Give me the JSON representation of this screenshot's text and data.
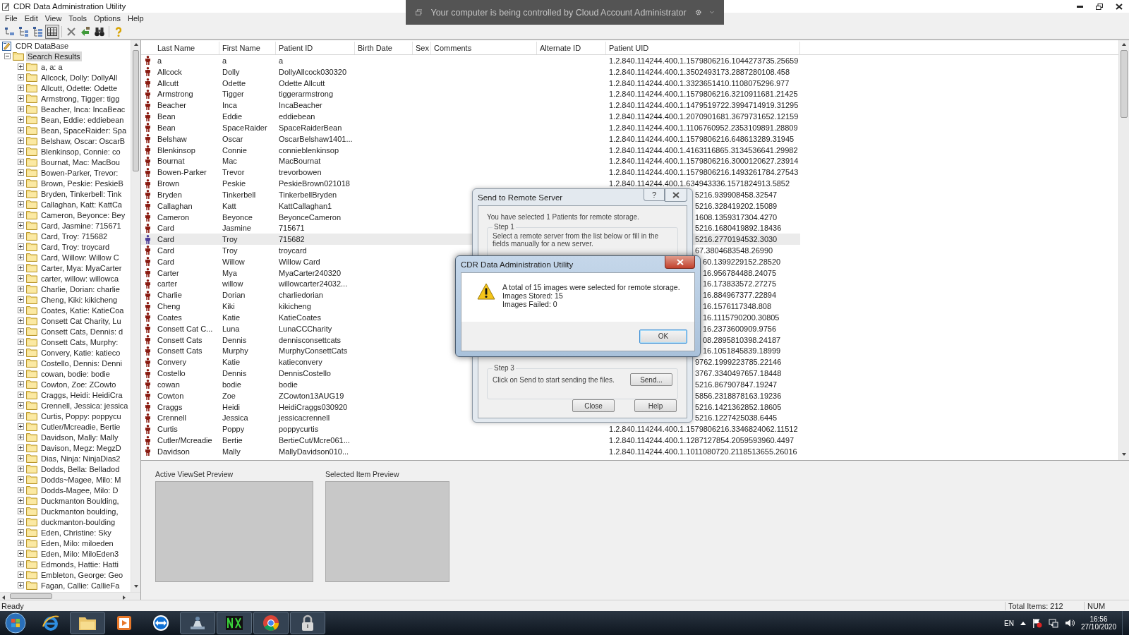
{
  "window": {
    "title": "CDR Data Administration Utility"
  },
  "remote_banner": {
    "text": "Your computer is being controlled by Cloud Account Administrator"
  },
  "menu": [
    "File",
    "Edit",
    "View",
    "Tools",
    "Options",
    "Help"
  ],
  "toolbar": [
    {
      "selected": false
    },
    {
      "selected": false
    },
    {
      "selected": false
    },
    {
      "selected": true
    },
    {
      "selected": false
    },
    {
      "selected": false
    },
    {
      "selected": false
    },
    {
      "selected": false
    }
  ],
  "tree": {
    "root": {
      "label": "CDR DataBase",
      "children": [
        {
          "label": "Search Results",
          "expanded": true,
          "selected": true,
          "children": [
            {
              "label": "a, a: a",
              "expanded": false,
              "selected": false
            },
            {
              "label": "Allcock, Dolly: DollyAll",
              "expanded": false,
              "selected": false
            },
            {
              "label": "Allcutt, Odette: Odette",
              "expanded": false,
              "selected": false
            },
            {
              "label": "Armstrong, Tigger: tigg",
              "expanded": false,
              "selected": false
            },
            {
              "label": "Beacher, Inca: IncaBeac",
              "expanded": false,
              "selected": false
            },
            {
              "label": "Bean, Eddie: eddiebean",
              "expanded": false,
              "selected": false
            },
            {
              "label": "Bean, SpaceRaider: Spa",
              "expanded": false,
              "selected": false
            },
            {
              "label": "Belshaw, Oscar: OscarB",
              "expanded": false,
              "selected": false
            },
            {
              "label": "Blenkinsop, Connie: co",
              "expanded": false,
              "selected": false
            },
            {
              "label": "Bournat, Mac: MacBou",
              "expanded": false,
              "selected": false
            },
            {
              "label": "Bowen-Parker, Trevor:",
              "expanded": false,
              "selected": false
            },
            {
              "label": "Brown, Peskie: PeskieB",
              "expanded": false,
              "selected": false
            },
            {
              "label": "Bryden, Tinkerbell: Tink",
              "expanded": false,
              "selected": false
            },
            {
              "label": "Callaghan, Katt: KattCa",
              "expanded": false,
              "selected": false
            },
            {
              "label": "Cameron, Beyonce: Bey",
              "expanded": false,
              "selected": false
            },
            {
              "label": "Card, Jasmine: 715671",
              "expanded": false,
              "selected": false
            },
            {
              "label": "Card, Troy: 715682",
              "expanded": false,
              "selected": false
            },
            {
              "label": "Card, Troy: troycard",
              "expanded": false,
              "selected": false
            },
            {
              "label": "Card, Willow: Willow C",
              "expanded": false,
              "selected": false
            },
            {
              "label": "Carter, Mya: MyaCarter",
              "expanded": false,
              "selected": false
            },
            {
              "label": "carter, willow: willowca",
              "expanded": false,
              "selected": false
            },
            {
              "label": "Charlie, Dorian: charlie",
              "expanded": false,
              "selected": false
            },
            {
              "label": "Cheng, Kiki: kikicheng",
              "expanded": false,
              "selected": false
            },
            {
              "label": "Coates, Katie: KatieCoa",
              "expanded": false,
              "selected": false
            },
            {
              "label": "Consett Cat Charity, Lu",
              "expanded": false,
              "selected": false
            },
            {
              "label": "Consett Cats, Dennis: d",
              "expanded": false,
              "selected": false
            },
            {
              "label": "Consett Cats, Murphy:",
              "expanded": false,
              "selected": false
            },
            {
              "label": "Convery, Katie: katieco",
              "expanded": false,
              "selected": false
            },
            {
              "label": "Costello, Dennis: Denni",
              "expanded": false,
              "selected": false
            },
            {
              "label": "cowan, bodie: bodie",
              "expanded": false,
              "selected": false
            },
            {
              "label": "Cowton, Zoe: ZCowto",
              "expanded": false,
              "selected": false
            },
            {
              "label": "Craggs, Heidi: HeidiCra",
              "expanded": false,
              "selected": false
            },
            {
              "label": "Crennell, Jessica: jessica",
              "expanded": false,
              "selected": false
            },
            {
              "label": "Curtis, Poppy: poppycu",
              "expanded": false,
              "selected": false
            },
            {
              "label": "Cutler/Mcreadie, Bertie",
              "expanded": false,
              "selected": false
            },
            {
              "label": "Davidson, Mally: Mally",
              "expanded": false,
              "selected": false
            },
            {
              "label": "Davison, Megz: MegzD",
              "expanded": false,
              "selected": false
            },
            {
              "label": "Dias, Ninja: NinjaDias2",
              "expanded": false,
              "selected": false
            },
            {
              "label": "Dodds, Bella: Belladod",
              "expanded": false,
              "selected": false
            },
            {
              "label": "Dodds~Magee, Milo: M",
              "expanded": false,
              "selected": false
            },
            {
              "label": "Dodds-Magee, Milo: D",
              "expanded": false,
              "selected": false
            },
            {
              "label": "Duckmanton Boulding,",
              "expanded": false,
              "selected": false
            },
            {
              "label": "Duckmanton boulding,",
              "expanded": false,
              "selected": false
            },
            {
              "label": "duckmanton-boulding",
              "expanded": false,
              "selected": false
            },
            {
              "label": "Eden, Christine: Sky",
              "expanded": false,
              "selected": false
            },
            {
              "label": "Eden, Milo: miloeden",
              "expanded": false,
              "selected": false
            },
            {
              "label": "Eden, Milo: MiloEden3",
              "expanded": false,
              "selected": false
            },
            {
              "label": "Edmonds, Hattie: Hatti",
              "expanded": false,
              "selected": false
            },
            {
              "label": "Embleton, George: Geo",
              "expanded": false,
              "selected": false
            },
            {
              "label": "Fagan, Callie: CallieFa",
              "expanded": false,
              "selected": false
            }
          ]
        }
      ]
    }
  },
  "table": {
    "columns": [
      "Last Name",
      "First Name",
      "Patient ID",
      "Birth Date",
      "Sex",
      "Comments",
      "Alternate ID",
      "Patient UID"
    ],
    "rows": [
      {
        "last_name": "a",
        "first_name": "a",
        "patient_id": "a",
        "patient_uid": "1.2.840.114244.400.1.1579806216.1044273735.25659",
        "selected": false
      },
      {
        "last_name": "Allcock",
        "first_name": "Dolly",
        "patient_id": "DollyAllcock030320",
        "patient_uid": "1.2.840.114244.400.1.3502493173.2887280108.458",
        "selected": false
      },
      {
        "last_name": "Allcutt",
        "first_name": "Odette",
        "patient_id": "Odette Allcutt",
        "patient_uid": "1.2.840.114244.400.1.3323651410.1108075296.977",
        "selected": false
      },
      {
        "last_name": "Armstrong",
        "first_name": "Tigger",
        "patient_id": "tiggerarmstrong",
        "patient_uid": "1.2.840.114244.400.1.1579806216.3210911681.21425",
        "selected": false
      },
      {
        "last_name": "Beacher",
        "first_name": "Inca",
        "patient_id": "IncaBeacher",
        "patient_uid": "1.2.840.114244.400.1.1479519722.3994714919.31295",
        "selected": false
      },
      {
        "last_name": "Bean",
        "first_name": "Eddie",
        "patient_id": "eddiebean",
        "patient_uid": "1.2.840.114244.400.1.2070901681.3679731652.12159",
        "selected": false
      },
      {
        "last_name": "Bean",
        "first_name": "SpaceRaider",
        "patient_id": "SpaceRaiderBean",
        "patient_uid": "1.2.840.114244.400.1.1106760952.2353109891.28809",
        "selected": false
      },
      {
        "last_name": "Belshaw",
        "first_name": "Oscar",
        "patient_id": "OscarBelshaw1401...",
        "patient_uid": "1.2.840.114244.400.1.1579806216.648613289.31945",
        "selected": false
      },
      {
        "last_name": "Blenkinsop",
        "first_name": "Connie",
        "patient_id": "connieblenkinsop",
        "patient_uid": "1.2.840.114244.400.1.4163116865.3134536641.29982",
        "selected": false
      },
      {
        "last_name": "Bournat",
        "first_name": "Mac",
        "patient_id": "MacBournat",
        "patient_uid": "1.2.840.114244.400.1.1579806216.3000120627.23914",
        "selected": false
      },
      {
        "last_name": "Bowen-Parker",
        "first_name": "Trevor",
        "patient_id": "trevorbowen",
        "patient_uid": "1.2.840.114244.400.1.1579806216.1493261784.27543",
        "selected": false
      },
      {
        "last_name": "Brown",
        "first_name": "Peskie",
        "patient_id": "PeskieBrown021018",
        "patient_uid": "1.2.840.114244.400.1.634943336.1571824913.5852",
        "selected": false
      },
      {
        "last_name": "Bryden",
        "first_name": "Tinkerbell",
        "patient_id": "TinkerbellBryden",
        "patient_uid": "5216.939908458.32547",
        "selected": false
      },
      {
        "last_name": "Callaghan",
        "first_name": "Katt",
        "patient_id": "KattCallaghan1",
        "patient_uid": "5216.328419202.15089",
        "selected": false
      },
      {
        "last_name": "Cameron",
        "first_name": "Beyonce",
        "patient_id": "BeyonceCameron",
        "patient_uid": "1608.1359317304.4270",
        "selected": false
      },
      {
        "last_name": "Card",
        "first_name": "Jasmine",
        "patient_id": "715671",
        "patient_uid": "5216.1680419892.18436",
        "selected": false
      },
      {
        "last_name": "Card",
        "first_name": "Troy",
        "patient_id": "715682",
        "patient_uid": "5216.2770194532.3030",
        "selected": true
      },
      {
        "last_name": "Card",
        "first_name": "Troy",
        "patient_id": "troycard",
        "patient_uid": "67.3804683548.26990",
        "selected": false
      },
      {
        "last_name": "Card",
        "first_name": "Willow",
        "patient_id": "Willow Card",
        "patient_uid": "60.1399229152.28520",
        "selected": false
      },
      {
        "last_name": "Carter",
        "first_name": "Mya",
        "patient_id": "MyaCarter240320",
        "patient_uid": "16.956784488.24075",
        "selected": false
      },
      {
        "last_name": "carter",
        "first_name": "willow",
        "patient_id": "willowcarter24032...",
        "patient_uid": "16.173833572.27275",
        "selected": false
      },
      {
        "last_name": "Charlie",
        "first_name": "Dorian",
        "patient_id": "charliedorian",
        "patient_uid": "16.884967377.22894",
        "selected": false
      },
      {
        "last_name": "Cheng",
        "first_name": "Kiki",
        "patient_id": "kikicheng",
        "patient_uid": "16.1576117348.808",
        "selected": false
      },
      {
        "last_name": "Coates",
        "first_name": "Katie",
        "patient_id": "KatieCoates",
        "patient_uid": "16.1115790200.30805",
        "selected": false
      },
      {
        "last_name": "Consett Cat C...",
        "first_name": "Luna",
        "patient_id": "LunaCCCharity",
        "patient_uid": "16.2373600909.9756",
        "selected": false
      },
      {
        "last_name": "Consett Cats",
        "first_name": "Dennis",
        "patient_id": "dennisconsettcats",
        "patient_uid": "08.2895810398.24187",
        "selected": false
      },
      {
        "last_name": "Consett Cats",
        "first_name": "Murphy",
        "patient_id": "MurphyConsettCats",
        "patient_uid": "16.1051845839.18999",
        "selected": false
      },
      {
        "last_name": "Convery",
        "first_name": "Katie",
        "patient_id": "katieconvery",
        "patient_uid": "9762.1999223785.22146",
        "selected": false
      },
      {
        "last_name": "Costello",
        "first_name": "Dennis",
        "patient_id": "DennisCostello",
        "patient_uid": "3767.3340497657.18448",
        "selected": false
      },
      {
        "last_name": "cowan",
        "first_name": "bodie",
        "patient_id": "bodie",
        "patient_uid": "5216.867907847.19247",
        "selected": false
      },
      {
        "last_name": "Cowton",
        "first_name": "Zoe",
        "patient_id": "ZCowton13AUG19",
        "patient_uid": "5856.2318878163.19236",
        "selected": false
      },
      {
        "last_name": "Craggs",
        "first_name": "Heidi",
        "patient_id": "HeidiCraggs030920",
        "patient_uid": "5216.1421362852.18605",
        "selected": false
      },
      {
        "last_name": "Crennell",
        "first_name": "Jessica",
        "patient_id": "jessicacrennell",
        "patient_uid": "5216.1227425038.6445",
        "selected": false
      },
      {
        "last_name": "Curtis",
        "first_name": "Poppy",
        "patient_id": "poppycurtis",
        "patient_uid": "1.2.840.114244.400.1.1579806216.3346824062.11512",
        "selected": false
      },
      {
        "last_name": "Cutler/Mcreadie",
        "first_name": "Bertie",
        "patient_id": "BertieCut/Mcre061...",
        "patient_uid": "1.2.840.114244.400.1.1287127854.2059593960.4497",
        "selected": false
      },
      {
        "last_name": "Davidson",
        "first_name": "Mally",
        "patient_id": "MallyDavidson010...",
        "patient_uid": "1.2.840.114244.400.1.1011080720.2118513655.26016",
        "selected": false
      }
    ]
  },
  "previews": [
    {
      "title": "Active ViewSet Preview"
    },
    {
      "title": "Selected Item Preview"
    }
  ],
  "send_dialog": {
    "title": "Send to Remote Server",
    "help_glyph": "?",
    "intro": "You have selected 1 Patients for remote storage.",
    "step1_title": "Step 1",
    "step1_text": "Select a remote server from the list below or fill in the fields manually for a new server.",
    "step3_title": "Step 3",
    "step3_text": "Click on Send to start sending the files.",
    "send_button": "Send...",
    "buttons": [
      "Close",
      "Help"
    ]
  },
  "message_box": {
    "title": "CDR Data Administration Utility",
    "lines": [
      "A total of 15 images were selected for remote storage.",
      "Images Stored: 15",
      "Images Failed: 0"
    ],
    "button": "OK"
  },
  "status_bar": {
    "text": "Ready",
    "total": "Total Items: 212",
    "num": "NUM"
  },
  "tray": {
    "language": "EN",
    "time": "16:56",
    "date": "27/10/2020"
  }
}
